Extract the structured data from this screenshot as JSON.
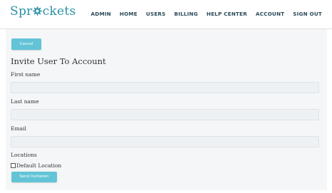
{
  "header": {
    "logo": {
      "before": "Spr",
      "after": "ckets",
      "brand_color": "#2a8fa6"
    },
    "nav": [
      "ADMIN",
      "HOME",
      "USERS",
      "BILLING",
      "HELP CENTER",
      "ACCOUNT",
      "SIGN OUT"
    ]
  },
  "form": {
    "cancel_label": "Cancel",
    "title": "Invite User To Account",
    "first_name_label": "First name",
    "first_name_value": "",
    "last_name_label": "Last name",
    "last_name_value": "",
    "email_label": "Email",
    "email_value": "",
    "locations_label": "Locations",
    "default_location_label": "Default Location",
    "default_location_checked": false,
    "send_label": "Send Invitation"
  },
  "colors": {
    "button": "#62c4d6",
    "panel": "#f4f6f7",
    "input": "#eef1f3",
    "nav_text": "#2b4a5a"
  },
  "icons": [
    "gear-icon"
  ]
}
